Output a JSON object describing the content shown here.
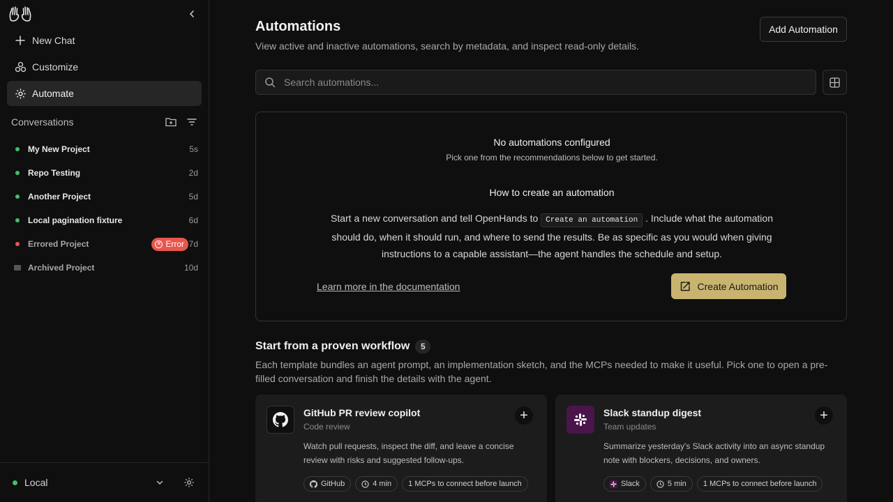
{
  "sidebar": {
    "nav": [
      {
        "label": "New Chat",
        "icon": "plus-icon"
      },
      {
        "label": "Customize",
        "icon": "components-icon"
      },
      {
        "label": "Automate",
        "icon": "gear-icon"
      }
    ],
    "conversations_label": "Conversations",
    "conversations": [
      {
        "name": "My New Project",
        "age": "5s",
        "status": "active"
      },
      {
        "name": "Repo Testing",
        "age": "2d",
        "status": "active"
      },
      {
        "name": "Another Project",
        "age": "5d",
        "status": "active"
      },
      {
        "name": "Local pagination fixture",
        "age": "6d",
        "status": "active"
      },
      {
        "name": "Errored Project",
        "age": "7d",
        "status": "error",
        "badge": "Error"
      },
      {
        "name": "Archived Project",
        "age": "10d",
        "status": "archived"
      }
    ],
    "footer": {
      "env": "Local"
    }
  },
  "main": {
    "title": "Automations",
    "subtitle": "View active and inactive automations, search by metadata, and inspect read-only details.",
    "add_button": "Add Automation",
    "search_placeholder": "Search automations...",
    "empty": {
      "title": "No automations configured",
      "subtitle": "Pick one from the recommendations below to get started.",
      "how_title": "How to create an automation",
      "body_before": "Start a new conversation and tell OpenHands to",
      "body_code": "Create an automation",
      "body_after": ". Include what the automation should do, when it should run, and where to send the results. Be as specific as you would when giving instructions to a capable assistant—the agent handles the schedule and setup.",
      "link": "Learn more in the documentation",
      "create_button": "Create Automation"
    },
    "workflows": {
      "title": "Start from a proven workflow",
      "count": "5",
      "description": "Each template bundles an agent prompt, an implementation sketch, and the MCPs needed to make it useful. Pick one to open a pre-filled conversation and finish the details with the agent.",
      "templates": [
        {
          "name": "GitHub PR review copilot",
          "category": "Code review",
          "description": "Watch pull requests, inspect the diff, and leave a concise review with risks and suggested follow-ups.",
          "chips": [
            "GitHub",
            "4 min",
            "1 MCPs to connect before launch"
          ],
          "icon": "github-icon"
        },
        {
          "name": "Slack standup digest",
          "category": "Team updates",
          "description": "Summarize yesterday's Slack activity into an async standup note with blockers, decisions, and owners.",
          "chips": [
            "Slack",
            "5 min",
            "1 MCPs to connect before launch"
          ],
          "icon": "slack-icon"
        }
      ]
    }
  },
  "colors": {
    "accent": "#c9b46f",
    "active_dot": "#3ec16b",
    "error": "#e8564c",
    "background": "#0f0f0f"
  }
}
